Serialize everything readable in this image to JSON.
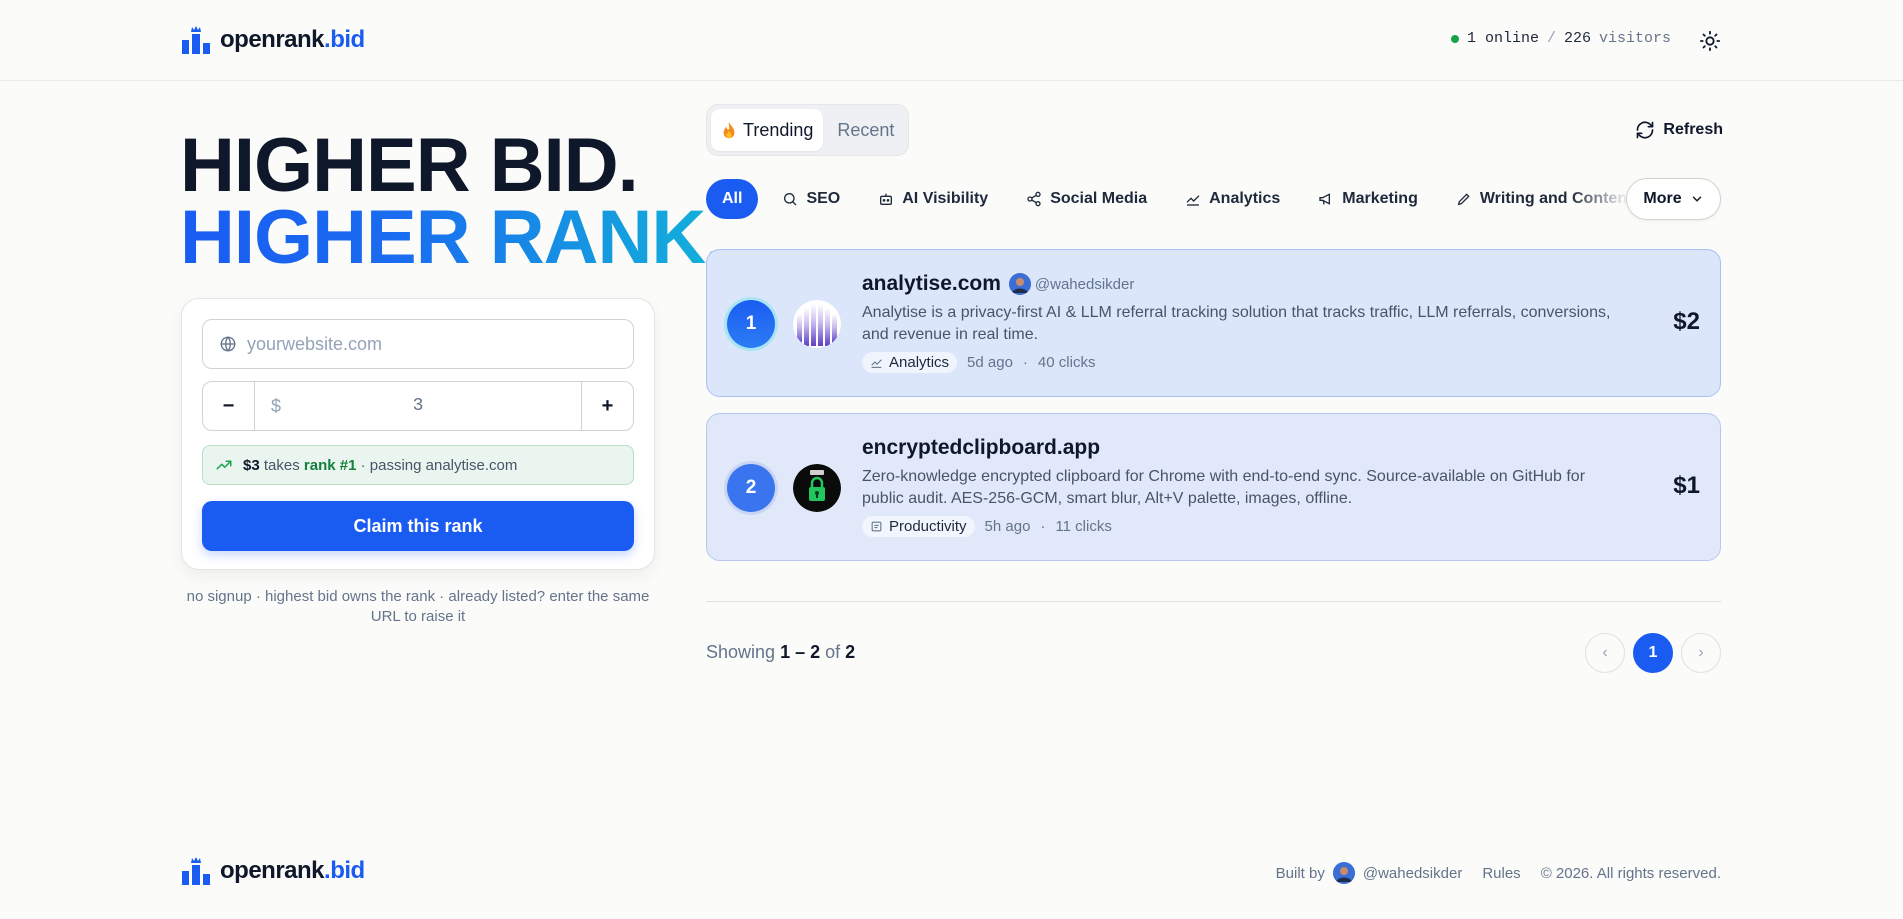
{
  "header": {
    "brand_main": "openrank",
    "brand_accent": ".bid",
    "online": "1 online",
    "separator": "/",
    "visitors_count": "226",
    "visitors_label": "visitors"
  },
  "hero": {
    "line1": "HIGHER BID.",
    "line2": "HIGHER RANK."
  },
  "form": {
    "url_placeholder": "yourwebsite.com",
    "url_value": "",
    "minus": "−",
    "plus": "+",
    "currency": "$",
    "amount": "3",
    "hint_price": "$3",
    "hint_takes": "takes",
    "hint_rank": "rank #1",
    "hint_rest": "· passing analytise.com",
    "claim_label": "Claim this rank",
    "note": "no signup · highest bid owns the rank · already listed? enter the same URL to raise it"
  },
  "tabs": {
    "trending": "Trending",
    "recent": "Recent",
    "refresh": "Refresh"
  },
  "categories": [
    {
      "label": "All",
      "icon": "none"
    },
    {
      "label": "SEO",
      "icon": "search-icon"
    },
    {
      "label": "AI Visibility",
      "icon": "bot-icon"
    },
    {
      "label": "Social Media",
      "icon": "share-icon"
    },
    {
      "label": "Analytics",
      "icon": "chart-icon"
    },
    {
      "label": "Marketing",
      "icon": "megaphone-icon"
    },
    {
      "label": "Writing and Content",
      "icon": "pen-icon"
    }
  ],
  "more_label": "More",
  "listings": [
    {
      "rank": "1",
      "name": "analytise.com",
      "user": "@wahedsikder",
      "description": "Analytise is a privacy-first AI & LLM referral tracking solution that tracks traffic, LLM referrals, conversions, and revenue in real time.",
      "category": "Analytics",
      "age": "5d ago",
      "clicks": "40 clicks",
      "price": "$2"
    },
    {
      "rank": "2",
      "name": "encryptedclipboard.app",
      "user": "",
      "description": "Zero-knowledge encrypted clipboard for Chrome with end-to-end sync. Source-available on GitHub for public audit. AES-256-GCM, smart blur, Alt+V palette, images, offline.",
      "category": "Productivity",
      "age": "5h ago",
      "clicks": "11 clicks",
      "price": "$1"
    }
  ],
  "pagination": {
    "showing": "Showing",
    "range": "1 – 2",
    "of": "of",
    "total": "2",
    "prev": "‹",
    "page": "1",
    "next": "›"
  },
  "footer": {
    "brand_main": "openrank",
    "brand_accent": ".bid",
    "built_by": "Built by",
    "user": "@wahedsikder",
    "rules": "Rules",
    "copyright": "© 2026. All rights reserved."
  },
  "colors": {
    "accent": "#1a5cf2",
    "gradient_end": "#12b3d8",
    "online_dot": "#16a34a",
    "hint_bg": "#e9f5ee"
  }
}
